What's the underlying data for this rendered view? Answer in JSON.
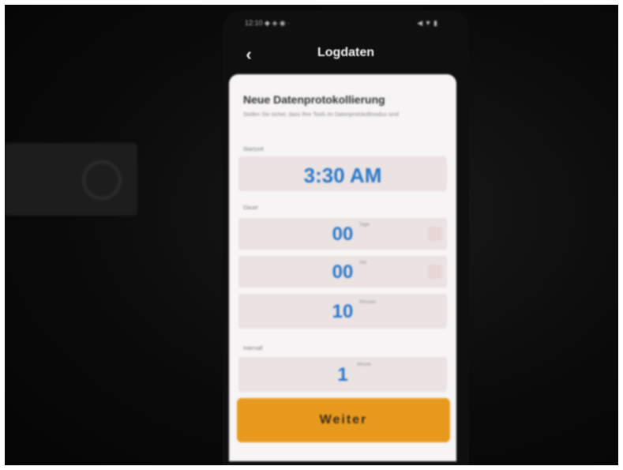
{
  "status_bar": {
    "left": "12:10 ◆ ◈ ◉ ·",
    "right": "◀ ▼ ▮"
  },
  "nav": {
    "back_icon": "‹",
    "title": "Logdaten"
  },
  "form": {
    "heading": "Neue Datenprotokollierung",
    "description": "Stellen Sie sicher, dass Ihre Tools im Datenprotokollmodus sind",
    "start_label": "Startzeit",
    "start_value": "3:30 AM",
    "duration_label": "Dauer",
    "duration": [
      {
        "value": "00",
        "unit": "Tage"
      },
      {
        "value": "00",
        "unit": "Std"
      },
      {
        "value": "10",
        "unit": "Minuten"
      }
    ],
    "interval_label": "Intervall",
    "interval": {
      "value": "1",
      "unit": "Minute"
    }
  },
  "next_button": {
    "label": "Weiter"
  },
  "colors": {
    "accent": "#e89a1e",
    "value_blue": "#2a78c8",
    "card": "#f6f4f4",
    "field": "#ebe2e2"
  },
  "icons": {
    "back": "chevron-left-icon"
  }
}
